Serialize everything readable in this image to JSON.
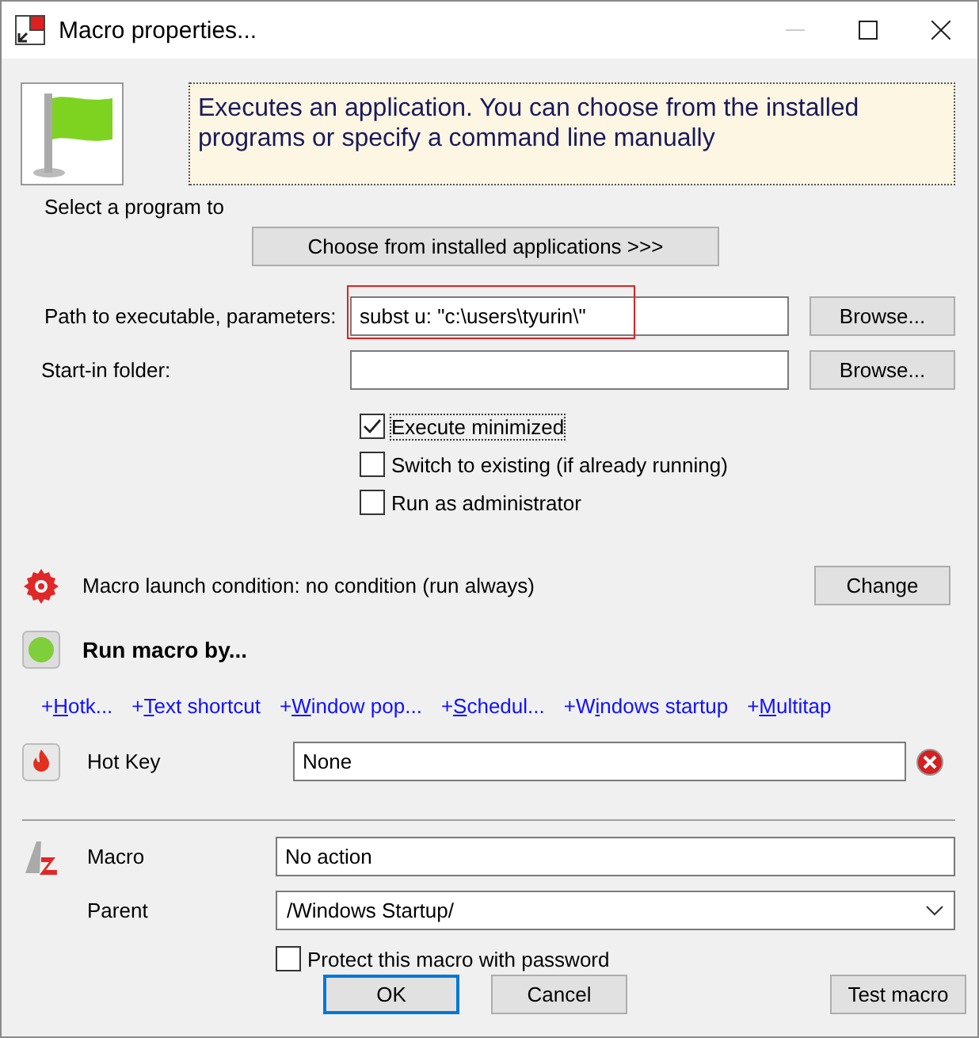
{
  "window": {
    "title": "Macro properties..."
  },
  "description": "Executes an application. You can choose from the installed programs or specify a command line manually",
  "select_label": "Select a program to",
  "choose_button": "Choose from installed applications >>>",
  "fields": [
    {
      "label": "Path to executable, parameters:",
      "value": "subst u: \"c:\\users\\tyurin\\\"",
      "highlighted": true,
      "button": "Browse..."
    },
    {
      "label": "Start-in folder:",
      "highlighted": false,
      "button": "Browse..."
    }
  ],
  "options": [
    {
      "label": "Execute minimized",
      "checked": true,
      "focused": true
    },
    {
      "label": "Switch to existing (if already running)",
      "checked": false,
      "focused": false
    },
    {
      "label": "Run as administrator",
      "checked": false,
      "focused": false
    }
  ],
  "condition": {
    "text": "Macro launch condition: no condition (run always)",
    "button": "Change"
  },
  "run_by": {
    "title": "Run macro by...",
    "links": [
      {
        "prefix": "+",
        "key": "H",
        "rest": "otk..."
      },
      {
        "prefix": "+",
        "key": "T",
        "rest": "ext shortcut"
      },
      {
        "prefix": "+",
        "key": "W",
        "rest": "indow pop..."
      },
      {
        "prefix": "+",
        "key": "S",
        "rest": "chedul..."
      },
      {
        "prefix": "+W",
        "key": "i",
        "rest": "ndows startup"
      },
      {
        "prefix": "+",
        "key": "M",
        "rest": "ultitap"
      }
    ]
  },
  "hotkey": {
    "label": "Hot Key",
    "value": "None"
  },
  "macro": {
    "label": "Macro",
    "value": "No action"
  },
  "parent": {
    "label": "Parent",
    "value": "/Windows Startup/"
  },
  "protect": {
    "label": "Protect this macro with password",
    "checked": false
  },
  "dialog_buttons": [
    {
      "label": "OK",
      "default": true
    },
    {
      "label": "Cancel",
      "default": false
    }
  ],
  "test_button": "Test macro"
}
